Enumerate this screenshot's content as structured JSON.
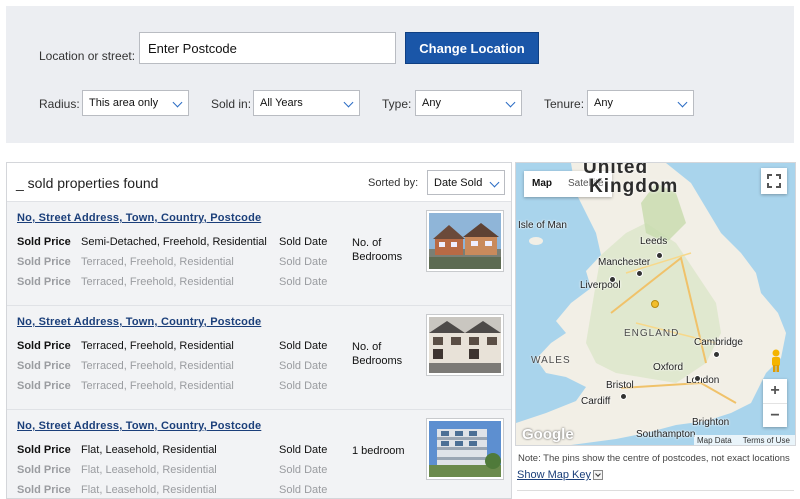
{
  "search": {
    "location_label": "Location or street:",
    "location_value": "Enter Postcode",
    "change_button": "Change Location"
  },
  "filters": {
    "radius": {
      "label": "Radius:",
      "value": "This area only"
    },
    "sold_in": {
      "label": "Sold in:",
      "value": "All Years"
    },
    "type": {
      "label": "Type:",
      "value": "Any"
    },
    "tenure": {
      "label": "Tenure:",
      "value": "Any"
    }
  },
  "results": {
    "count_text": "_ sold properties found",
    "sort_label": "Sorted by:",
    "sort_value": "Date Sold",
    "properties": [
      {
        "address": "No, Street Address, Town, Country, Postcode",
        "sales": [
          {
            "label": "Sold Price",
            "desc": "Semi-Detached, Freehold, Residential",
            "date": "Sold Date"
          },
          {
            "label": "Sold Price",
            "desc": "Terraced, Freehold, Residential",
            "date": "Sold Date"
          },
          {
            "label": "Sold Price",
            "desc": "Terraced, Freehold, Residential",
            "date": "Sold Date"
          }
        ],
        "bedrooms": "No. of Bedrooms"
      },
      {
        "address": "No, Street Address, Town, Country, Postcode",
        "sales": [
          {
            "label": "Sold Price",
            "desc": "Terraced, Freehold, Residential",
            "date": "Sold Date"
          },
          {
            "label": "Sold Price",
            "desc": "Terraced, Freehold, Residential",
            "date": "Sold Date"
          },
          {
            "label": "Sold Price",
            "desc": "Terraced, Freehold, Residential",
            "date": "Sold Date"
          }
        ],
        "bedrooms": "No. of Bedrooms"
      },
      {
        "address": "No, Street Address, Town, Country, Postcode",
        "sales": [
          {
            "label": "Sold Price",
            "desc": "Flat, Leasehold, Residential",
            "date": "Sold Date"
          },
          {
            "label": "Sold Price",
            "desc": "Flat, Leasehold, Residential",
            "date": "Sold Date"
          },
          {
            "label": "Sold Price",
            "desc": "Flat, Leasehold, Residential",
            "date": "Sold Date"
          }
        ],
        "bedrooms": "1 bedroom"
      }
    ]
  },
  "map": {
    "tab_map": "Map",
    "tab_satellite": "Satellite",
    "title_top": "United",
    "title_bottom": "Kingdom",
    "places": {
      "isle_of_man": "Isle of Man",
      "leeds": "Leeds",
      "manchester": "Manchester",
      "liverpool": "Liverpool",
      "england": "ENGLAND",
      "cambridge": "Cambridge",
      "wales": "WALES",
      "oxford": "Oxford",
      "bristol": "Bristol",
      "london": "London",
      "cardiff": "Cardiff",
      "brighton": "Brighton",
      "southampton": "Southampton"
    },
    "zoom_in": "+",
    "zoom_out": "−",
    "google": "Google",
    "map_data": "Map Data",
    "terms": "Terms of Use",
    "icons": [
      "fullscreen-icon",
      "pegman-icon"
    ]
  },
  "map_note": "Note: The pins show the centre of postcodes, not exact locations",
  "map_key": "Show Map Key"
}
